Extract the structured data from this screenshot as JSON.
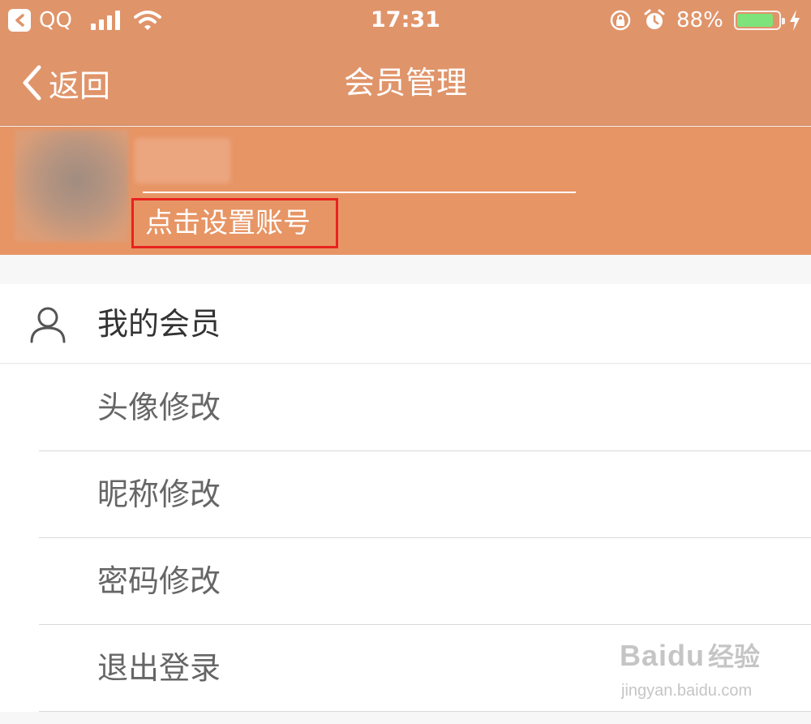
{
  "status_bar": {
    "carrier": "QQ",
    "time": "17:31",
    "battery_percent": "88%",
    "battery_level": 0.88,
    "icons": [
      "back-app-icon",
      "signal-icon",
      "wifi-icon",
      "rotation-lock-icon",
      "alarm-icon",
      "battery-icon",
      "charging-bolt-icon"
    ]
  },
  "nav": {
    "back_label": "返回",
    "title": "会员管理"
  },
  "profile": {
    "set_account_label": "点击设置账号"
  },
  "menu": {
    "header_label": "我的会员",
    "items": [
      {
        "label": "头像修改"
      },
      {
        "label": "昵称修改"
      },
      {
        "label": "密码修改"
      },
      {
        "label": "退出登录"
      }
    ]
  },
  "watermark": {
    "brand": "Baidu",
    "suffix": "经验",
    "url": "jingyan.baidu.com"
  },
  "colors": {
    "header_bg": "#e0946a",
    "profile_bg": "#e79565",
    "highlight_border": "#e8231f",
    "battery_fill": "#7de37a"
  }
}
